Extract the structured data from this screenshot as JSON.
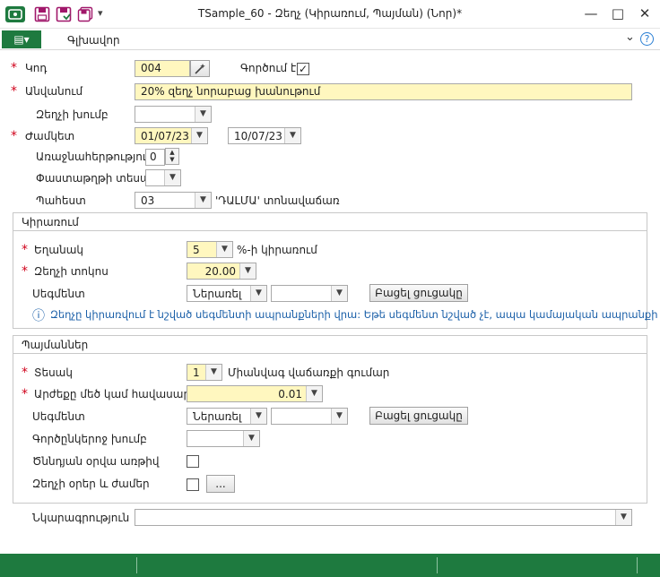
{
  "window": {
    "title": "TSample_60 - Զեղչ (Կիրառում, Պայման) (Նոր)*",
    "minimize": "—",
    "maximize": "□",
    "close": "✕"
  },
  "toolbar": {
    "dropdown_arrow": "▾"
  },
  "menu": {
    "toggle_glyph": "▤▾",
    "main_tab": "Գլխավոր",
    "collapse": "⌄",
    "help": "?"
  },
  "form": {
    "code": {
      "label": "Կոդ",
      "value": "004"
    },
    "active": {
      "label": "Գործում է",
      "checked": "✓"
    },
    "name": {
      "label": "Անվանում",
      "value": "20% զեղչ նորաբաց խանութում"
    },
    "discount_group": {
      "label": "Զեղչի խումբ",
      "value": ""
    },
    "period": {
      "label": "Ժամկետ",
      "from": "01/07/23",
      "to": "10/07/23"
    },
    "priority": {
      "label": "Առաջնահերթություն",
      "value": "0"
    },
    "document_type": {
      "label": "Փաստաթղթի տեսակ",
      "value": ""
    },
    "warehouse": {
      "label": "Պահեստ",
      "value": "03",
      "description": "'ԴԱԼՄԱ' տոնավաճառ"
    }
  },
  "application": {
    "title": "Կիրառում",
    "method": {
      "label": "Եղանակ",
      "value": "5",
      "suffix": "%-ի կիրառում"
    },
    "rate": {
      "label": "Զեղչի տոկոս",
      "value": "20.00"
    },
    "segment": {
      "label": "Սեգմենտ",
      "value": "Ներառել",
      "value2": "",
      "button": "Բացել ցուցակը"
    },
    "info_icon": "ⓘ",
    "info": "Զեղչը կիրառվում է նշված սեգմենտի ապրանքների վրա: Եթե սեգմենտ նշված չէ, ապա կամայական ապրանքի"
  },
  "conditions": {
    "title": "Պայմաններ",
    "type": {
      "label": "Տեսակ",
      "value": "1",
      "suffix": "Միանվագ վաճառքի գումար"
    },
    "amount": {
      "label": "Արժեքը մեծ կամ հավասար է",
      "value": "0.01"
    },
    "segment": {
      "label": "Սեգմենտ",
      "value": "Ներառել",
      "value2": "",
      "button": "Բացել ցուցակը"
    },
    "partner_group": {
      "label": "Գործընկերոջ խումբ",
      "value": ""
    },
    "birthday": {
      "label": "Ծննդյան օրվա առթիվ"
    },
    "days_hours": {
      "label": "Զեղչի օրեր և ժամեր",
      "button": "..."
    }
  },
  "description": {
    "label": "Նկարագրություն",
    "value": ""
  },
  "colors": {
    "accent": "#1e7a3f",
    "required": "#d0021b",
    "highlight": "#fff7bf",
    "info": "#1a5fa8"
  }
}
